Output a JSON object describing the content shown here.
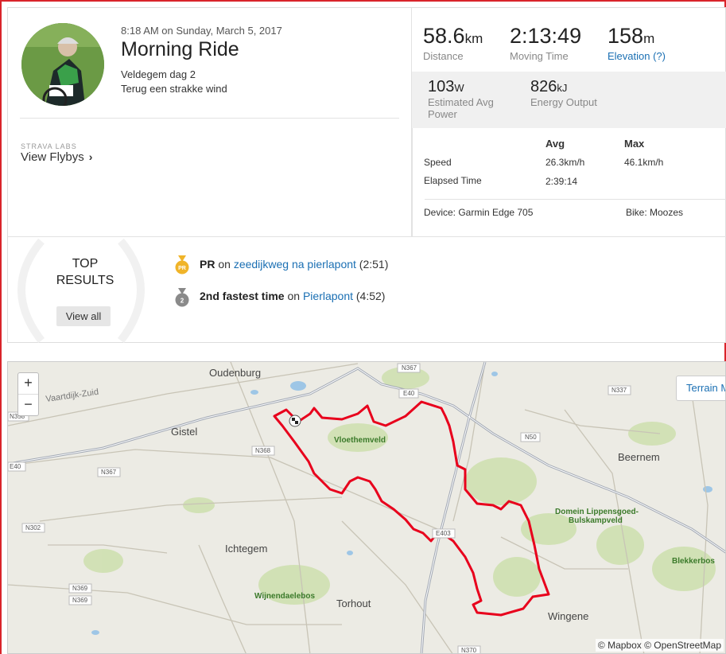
{
  "activity": {
    "datetime": "8:18 AM on Sunday, March 5, 2017",
    "title": "Morning Ride",
    "description_line1": "Veldegem dag 2",
    "description_line2": "Terug een strakke wind",
    "labs_label": "STRAVA LABS",
    "flyby_label": "View Flybys",
    "flyby_chevron": "›"
  },
  "stats": {
    "distance": {
      "value": "58.6",
      "unit": "km",
      "label": "Distance"
    },
    "moving_time": {
      "value": "2:13:49",
      "label": "Moving Time"
    },
    "elevation": {
      "value": "158",
      "unit": "m",
      "label": "Elevation (?)"
    },
    "power": {
      "value": "103",
      "unit": "W",
      "label_line1": "Estimated Avg",
      "label_line2": "Power"
    },
    "energy": {
      "value": "826",
      "unit": "kJ",
      "label": "Energy Output"
    }
  },
  "table": {
    "avg_header": "Avg",
    "max_header": "Max",
    "rows": [
      {
        "label": "Speed",
        "avg": "26.3km/h",
        "max": "46.1km/h"
      },
      {
        "label": "Elapsed Time",
        "avg": "2:39:14",
        "max": ""
      }
    ],
    "device": "Device: Garmin Edge 705",
    "bike": "Bike: Moozes"
  },
  "results": {
    "heading_line1": "TOP",
    "heading_line2": "RESULTS",
    "view_all": "View all",
    "items": [
      {
        "badge": "PR",
        "strong": "PR",
        "on": " on ",
        "segment": "zeedijkweg na pierlapont",
        "time": " (2:51)"
      },
      {
        "badge": "2",
        "strong": "2nd fastest time",
        "on": " on ",
        "segment": "Pierlapont",
        "time": " (4:52)"
      }
    ]
  },
  "map": {
    "zoom_in": "+",
    "zoom_out": "−",
    "terrain": "Terrain Map",
    "attribution": "© Mapbox © OpenStreetMap",
    "places": [
      "Oudenburg",
      "Gistel",
      "Vloethemveld",
      "Beernem",
      "Ichtegem",
      "Wijnendaelebos",
      "Torhout",
      "Wingene",
      "Domein Lippensgoed-",
      "Bulskampveld",
      "Blekkerbos",
      "Vaartdijk-Zuid"
    ],
    "roads": [
      "N367",
      "E40",
      "N337",
      "N358",
      "N368",
      "N50",
      "N367",
      "N302",
      "E403",
      "N369",
      "N369",
      "N370",
      "E40"
    ],
    "route_color": "#e8001c"
  }
}
